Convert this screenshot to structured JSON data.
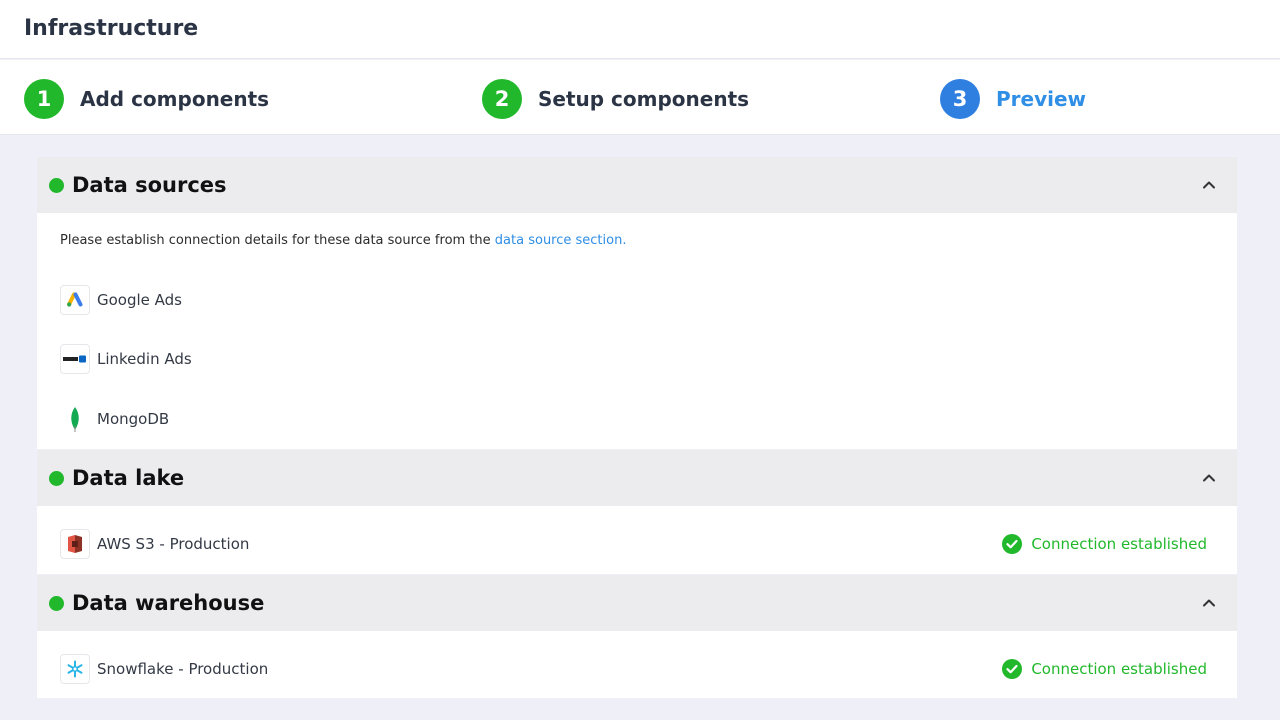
{
  "header": {
    "title": "Infrastructure"
  },
  "steps": [
    {
      "number": "1",
      "label": "Add components",
      "state": "done"
    },
    {
      "number": "2",
      "label": "Setup components",
      "state": "done"
    },
    {
      "number": "3",
      "label": "Preview",
      "state": "active"
    }
  ],
  "sections": {
    "data_sources": {
      "title": "Data sources",
      "note": "Please establish connection details for these data source from the ",
      "note_link": "data source section.",
      "items": [
        {
          "name": "Google Ads",
          "icon": "google-ads-icon"
        },
        {
          "name": "Linkedin Ads",
          "icon": "linkedin-icon"
        },
        {
          "name": "MongoDB",
          "icon": "mongodb-icon"
        }
      ]
    },
    "data_lake": {
      "title": "Data lake",
      "items": [
        {
          "name": "AWS S3 - Production",
          "icon": "aws-s3-icon",
          "status": "Connection established"
        }
      ]
    },
    "data_warehouse": {
      "title": "Data warehouse",
      "items": [
        {
          "name": "Snowflake - Production",
          "icon": "snowflake-icon",
          "status": "Connection established"
        }
      ]
    }
  },
  "colors": {
    "success": "#22b82c",
    "accent": "#2f7fe0",
    "link": "#2f8ee5",
    "background": "#eff0f7"
  }
}
